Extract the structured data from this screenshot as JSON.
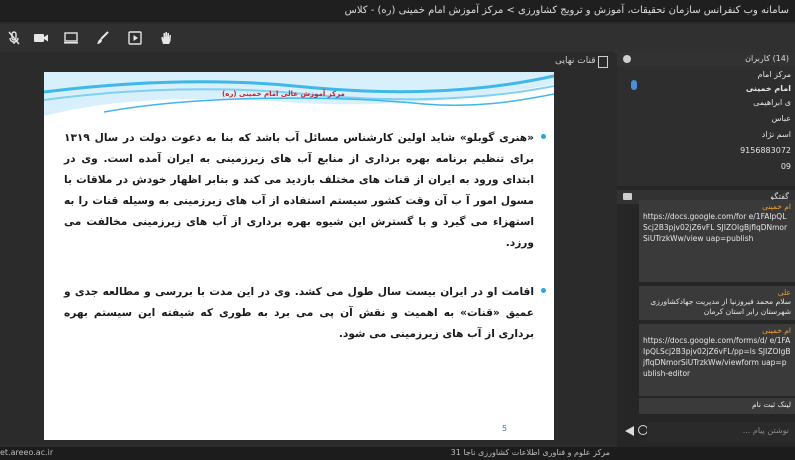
{
  "window": {
    "title": "سامانه وب کنفرانس سازمان تحقیقات، آموزش و ترویج کشاورزی > مرکز آموزش امام خمینی (ره) - کلاس"
  },
  "toolbar": {
    "icons": [
      "mic-off-icon",
      "camera-icon",
      "monitor-icon",
      "brush-icon",
      "play-icon",
      "hand-icon"
    ]
  },
  "stage": {
    "tab_label": "قنات نهایی",
    "slide": {
      "header_title": "مرکز آموزش عالی امام خمینی (ره)",
      "paragraph1": "«هنری گوبلو» شاید اولین کارشناس مسائل آب باشد که بنا به دعوت دولت در سال ۱۳۱۹ برای تنظیم برنامه بهره برداری از منابع آب های زیرزمینی به ایران آمده است. وی در ابتدای ورود به ایران از قنات های مختلف بازدید می کند و بنابر اظهار خودش در ملاقات با مسول امور آ ب آن وقت کشور سیستم استفاده از آب های زیرزمینی به وسیله قنات را به استهزاء می گیرد و با گسترش این شیوه بهره برداری از آب های زیرزمینی مخالفت می ورزد.",
      "paragraph2": "اقامت او در ایران بیست سال طول می کشد. وی در این مدت با بررسی و مطالعه جدی و عمیق «قنات» به اهمیت و نقش آن پی می برد به طوری که شیفته این سیستم بهره برداری از آب های زیرزمینی می شود.",
      "page_number": "5"
    }
  },
  "statusbar": {
    "status": "مرکز علوم و فناوری اطلاعات کشاورزی ناجا 31",
    "url": "et.areeo.ac.ir"
  },
  "rightpanel": {
    "users_header": "(14) کاربران",
    "users": [
      "مرکز امام",
      "امام خمینی",
      "ی ابراهیمی",
      "عباس",
      "اسم نژاد",
      "9156883072",
      "09"
    ],
    "chat_header": "گفتگو",
    "messages": [
      {
        "sender": "ام خمینی",
        "text": "https://docs.google.com/for e/1FAIpQLScj2B3pjv02jZ6vFL SJIZOIgBjflqDNmorSiUTrzkWw/view uap=publish"
      },
      {
        "sender": "علی",
        "text": "سلام محمد فیروزنیا از مدیریت جهادکشاورزی شهرستان رابر استان کرمان"
      },
      {
        "sender": "ام خمینی",
        "text": "https://docs.google.com/forms/d/ e/1FAIpQLScj2B3pjv02jZ6vFL/pp=ls SJIZOIgBjflqDNmorSiUTrzkWw/viewform uap=publish-editor"
      },
      {
        "sender": "",
        "text": "لینک ثبت نام"
      }
    ],
    "chat_placeholder": "نوشتن پیام ..."
  },
  "colors": {
    "slide_title": "#d0202b",
    "bullet": "#2aa6d8",
    "wave": "#3fb7e8"
  }
}
